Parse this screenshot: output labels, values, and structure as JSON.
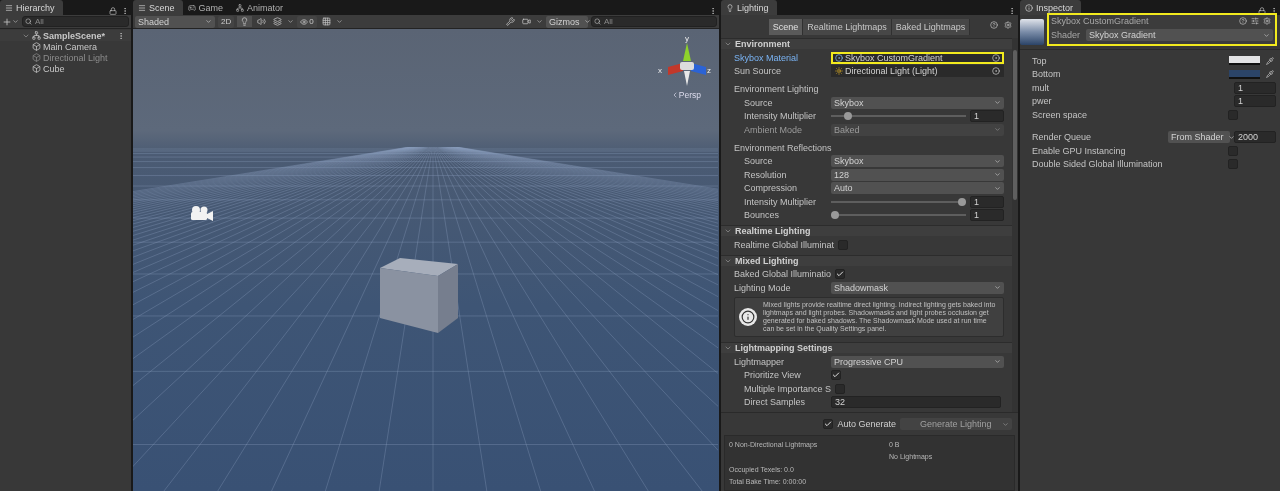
{
  "hierarchy": {
    "title": "Hierarchy",
    "search": {
      "placeholder": "All"
    },
    "tree": [
      {
        "label": "SampleScene*",
        "expanded": true,
        "children": [
          {
            "label": "Main Camera",
            "disabled": false
          },
          {
            "label": "Directional Light",
            "disabled": true
          },
          {
            "label": "Cube",
            "disabled": false
          }
        ]
      }
    ]
  },
  "scene": {
    "tabs": [
      {
        "label": "Scene",
        "selected": true,
        "kind": "scene"
      },
      {
        "label": "Game",
        "selected": false,
        "kind": "game"
      },
      {
        "label": "Animator",
        "selected": false,
        "kind": "animator"
      }
    ],
    "shading": "Shaded",
    "mode_2d": "2D",
    "hidden_count": "0",
    "gizmos": "Gizmos",
    "search": {
      "placeholder": "All"
    },
    "axes": {
      "x": "x",
      "y": "y",
      "z": "z"
    },
    "projection": "Persp"
  },
  "lighting": {
    "title": "Lighting",
    "tabs": [
      {
        "label": "Scene",
        "selected": true
      },
      {
        "label": "Realtime Lightmaps",
        "selected": false
      },
      {
        "label": "Baked Lightmaps",
        "selected": false
      }
    ],
    "sections": [
      {
        "title": "Environment",
        "expanded": true,
        "rows": [
          {
            "kind": "object",
            "label": "Skybox Material",
            "value": "Skybox CustomGradient",
            "focused": true,
            "highlighted": true
          },
          {
            "kind": "object",
            "label": "Sun Source",
            "value": "Directional Light (Light)",
            "focused": false,
            "highlighted": false
          },
          {
            "kind": "group",
            "label": "Environment Lighting",
            "children": [
              {
                "kind": "dropdown",
                "label": "Source",
                "value": "Skybox",
                "disabled": false
              },
              {
                "kind": "slider",
                "label": "Intensity Multiplier",
                "level": 0.1,
                "value": "1"
              },
              {
                "kind": "dropdown",
                "label": "Ambient Mode",
                "value": "Baked",
                "disabled": true
              }
            ]
          },
          {
            "kind": "group",
            "label": "Environment Reflections",
            "children": [
              {
                "kind": "dropdown",
                "label": "Source",
                "value": "Skybox",
                "disabled": false
              },
              {
                "kind": "dropdown",
                "label": "Resolution",
                "value": "128",
                "disabled": false
              },
              {
                "kind": "dropdown",
                "label": "Compression",
                "value": "Auto",
                "disabled": false
              },
              {
                "kind": "slider",
                "label": "Intensity Multiplier",
                "level": 1,
                "value": "1"
              },
              {
                "kind": "slider",
                "label": "Bounces",
                "level": 0,
                "value": "1"
              }
            ]
          }
        ]
      },
      {
        "title": "Realtime Lighting",
        "expanded": true,
        "rows": [
          {
            "kind": "checkbox",
            "label": "Realtime Global Illuminat",
            "checked": false
          }
        ]
      },
      {
        "title": "Mixed Lighting",
        "expanded": true,
        "rows": [
          {
            "kind": "checkbox",
            "label": "Baked Global Illuminatio",
            "checked": true
          },
          {
            "kind": "dropdown",
            "label": "Lighting Mode",
            "value": "Shadowmask",
            "disabled": false
          },
          {
            "kind": "help",
            "text": "Mixed lights provide realtime direct lighting. Indirect lighting gets baked into lightmaps and light probes. Shadowmasks and light probes occlusion get generated for baked shadows. The Shadowmask Mode used at run time can be set in the Quality Settings panel."
          }
        ]
      },
      {
        "title": "Lightmapping Settings",
        "expanded": true,
        "rows": [
          {
            "kind": "dropdown",
            "label": "Lightmapper",
            "value": "Progressive CPU",
            "disabled": false
          },
          {
            "kind": "group",
            "children": [
              {
                "kind": "checkbox",
                "label": "Prioritize View",
                "checked": true
              },
              {
                "kind": "checkbox",
                "label": "Multiple Importance S",
                "checked": false
              },
              {
                "kind": "number",
                "label": "Direct Samples",
                "value": "32"
              }
            ]
          }
        ]
      }
    ],
    "auto_generate": {
      "label": "Auto Generate",
      "checked": true
    },
    "generate_button": {
      "label": "Generate Lighting",
      "disabled": true
    },
    "stats": {
      "lightmaps": "0 Non-Directional Lightmaps",
      "size": "0 B",
      "status": "No Lightmaps",
      "texels": "Occupied Texels: 0.0",
      "bake_time": "Total Bake Time: 0:00:00"
    }
  },
  "inspector": {
    "title": "Inspector",
    "header": {
      "name": "Skybox CustomGradient",
      "shader_label": "Shader",
      "shader": "Skybox Gradient",
      "highlighted": true
    },
    "properties": [
      {
        "kind": "color",
        "label": "Top",
        "color": "#e4e4e6"
      },
      {
        "kind": "color",
        "label": "Bottom",
        "color": "#2b4468"
      },
      {
        "kind": "number",
        "label": "mult",
        "value": "1"
      },
      {
        "kind": "number",
        "label": "pwer",
        "value": "1"
      },
      {
        "kind": "checkbox",
        "label": "Screen space",
        "checked": false
      },
      {
        "kind": "queue",
        "label": "Render Queue",
        "option": "From Shader",
        "value": "2000"
      },
      {
        "kind": "checkbox",
        "label": "Enable GPU Instancing",
        "checked": false
      },
      {
        "kind": "checkbox",
        "label": "Double Sided Global Illumination",
        "checked": false
      }
    ]
  }
}
